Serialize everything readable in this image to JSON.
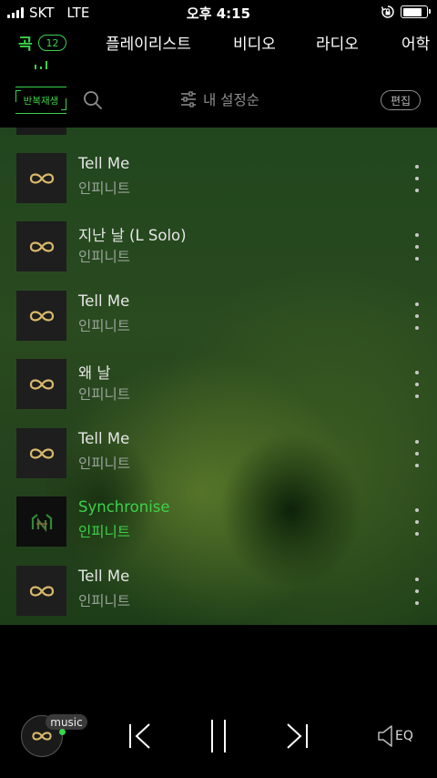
{
  "status": {
    "carrier": "SKT",
    "network": "LTE",
    "time": "오후 4:15"
  },
  "tabs": [
    {
      "label": "곡",
      "active": true,
      "count": "12"
    },
    {
      "label": "플레이리스트"
    },
    {
      "label": "비디오"
    },
    {
      "label": "라디오"
    },
    {
      "label": "어학"
    }
  ],
  "toolbar": {
    "repeat_label": "반복재생",
    "sort_label": "내 설정순",
    "edit_label": "편집"
  },
  "songs": [
    {
      "title": "Tell Me",
      "artist": "인피니트",
      "playing": false
    },
    {
      "title": "지난 날 (L Solo)",
      "artist": "인피니트",
      "playing": false
    },
    {
      "title": "Tell Me",
      "artist": "인피니트",
      "playing": false
    },
    {
      "title": "왜 날",
      "artist": "인피니트",
      "playing": false
    },
    {
      "title": "Tell Me",
      "artist": "인피니트",
      "playing": false
    },
    {
      "title": "Synchronise",
      "artist": "인피니트",
      "playing": true
    },
    {
      "title": "Tell Me",
      "artist": "인피니트",
      "playing": false
    }
  ],
  "player": {
    "badge": "music",
    "eq_label": "EQ"
  },
  "colors": {
    "accent": "#3cd24a",
    "logo_gold": "#d9b96b"
  }
}
